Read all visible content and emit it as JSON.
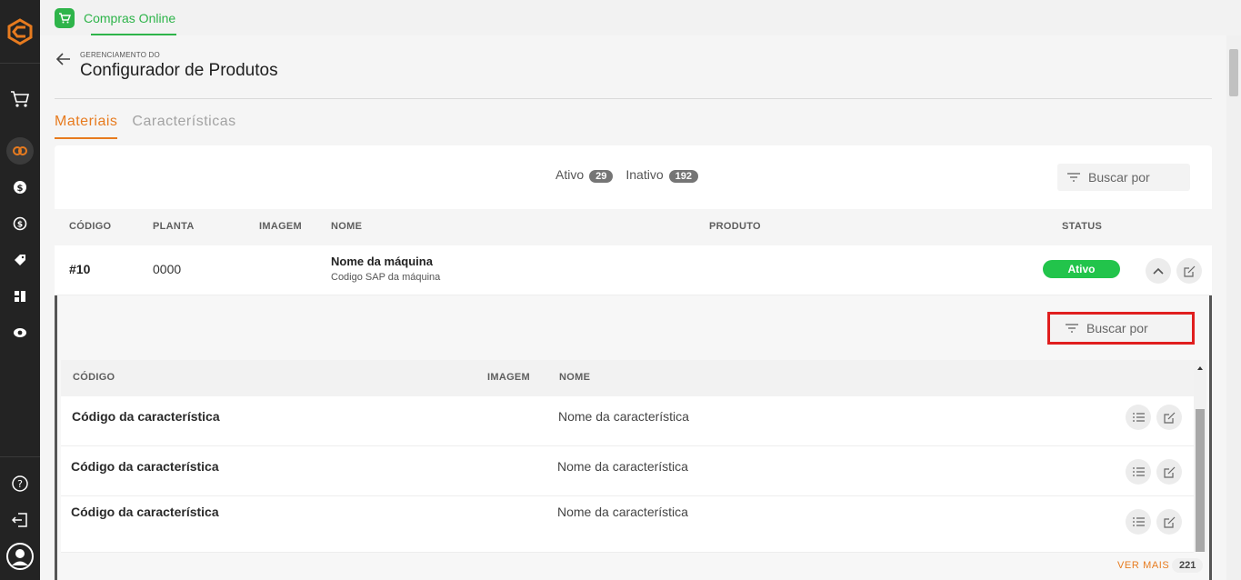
{
  "app": {
    "name": "Compras Online",
    "accent": "#2eb44a",
    "brand": "#e77b1f"
  },
  "rail": {
    "icons": [
      "logo-icon",
      "cart-icon",
      "settings-gear-icon",
      "dollar-icon",
      "refresh-dollar-icon",
      "tag-icon",
      "grid-icon",
      "eye-icon",
      "help-icon",
      "logout-icon",
      "user-avatar-icon"
    ]
  },
  "header": {
    "breadcrumb": "GERENCIAMENTO DO",
    "title": "Configurador de Produtos"
  },
  "tabs": [
    {
      "label": "Materiais",
      "active": true
    },
    {
      "label": "Características",
      "active": false
    }
  ],
  "filter": {
    "active_label": "Ativo",
    "active_count": "29",
    "inactive_label": "Inativo",
    "inactive_count": "192",
    "search_placeholder": "Buscar por"
  },
  "table": {
    "headers": [
      "CÓDIGO",
      "PLANTA",
      "IMAGEM",
      "NOME",
      "PRODUTO",
      "STATUS"
    ],
    "row": {
      "code": "#10",
      "plant": "0000",
      "name": "Nome da máquina",
      "sap": "Codigo SAP da máquina",
      "status": "Ativo"
    }
  },
  "sub": {
    "search_placeholder": "Buscar por",
    "headers": [
      "CÓDIGO",
      "IMAGEM",
      "NOME"
    ],
    "rows": [
      {
        "code": "Código da característica",
        "name": "Nome da característica"
      },
      {
        "code": "Código da característica",
        "name": "Nome da característica"
      },
      {
        "code": "Código da característica",
        "name": "Nome da característica"
      }
    ]
  },
  "footer": {
    "more_label": "VER MAIS",
    "more_count": "221"
  }
}
